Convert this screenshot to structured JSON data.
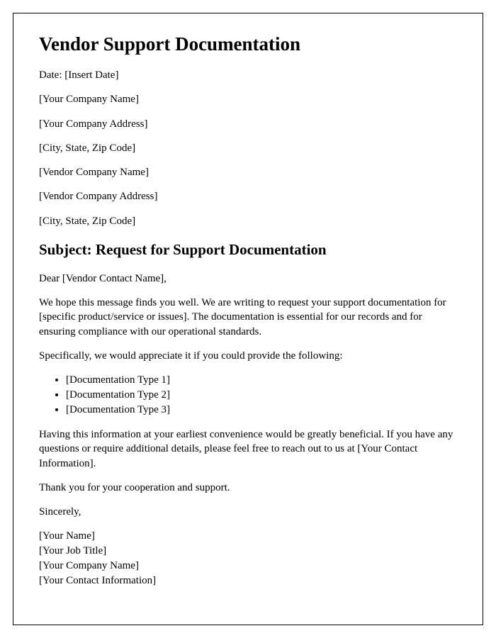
{
  "title": "Vendor Support Documentation",
  "header": {
    "date": "Date: [Insert Date]",
    "yourCompanyName": "[Your Company Name]",
    "yourCompanyAddress": "[Your Company Address]",
    "yourCityStateZip": "[City, State, Zip Code]",
    "vendorCompanyName": "[Vendor Company Name]",
    "vendorCompanyAddress": "[Vendor Company Address]",
    "vendorCityStateZip": "[City, State, Zip Code]"
  },
  "subject": "Subject: Request for Support Documentation",
  "salutation": "Dear [Vendor Contact Name],",
  "para1": "We hope this message finds you well. We are writing to request your support documentation for [specific product/service or issues]. The documentation is essential for our records and for ensuring compliance with our operational standards.",
  "para2": "Specifically, we would appreciate it if you could provide the following:",
  "items": [
    "[Documentation Type 1]",
    "[Documentation Type 2]",
    "[Documentation Type 3]"
  ],
  "para3": "Having this information at your earliest convenience would be greatly beneficial. If you have any questions or require additional details, please feel free to reach out to us at [Your Contact Information].",
  "para4": "Thank you for your cooperation and support.",
  "closing": "Sincerely,",
  "signature": {
    "name": "[Your Name]",
    "jobTitle": "[Your Job Title]",
    "companyName": "[Your Company Name]",
    "contactInfo": "[Your Contact Information]"
  }
}
